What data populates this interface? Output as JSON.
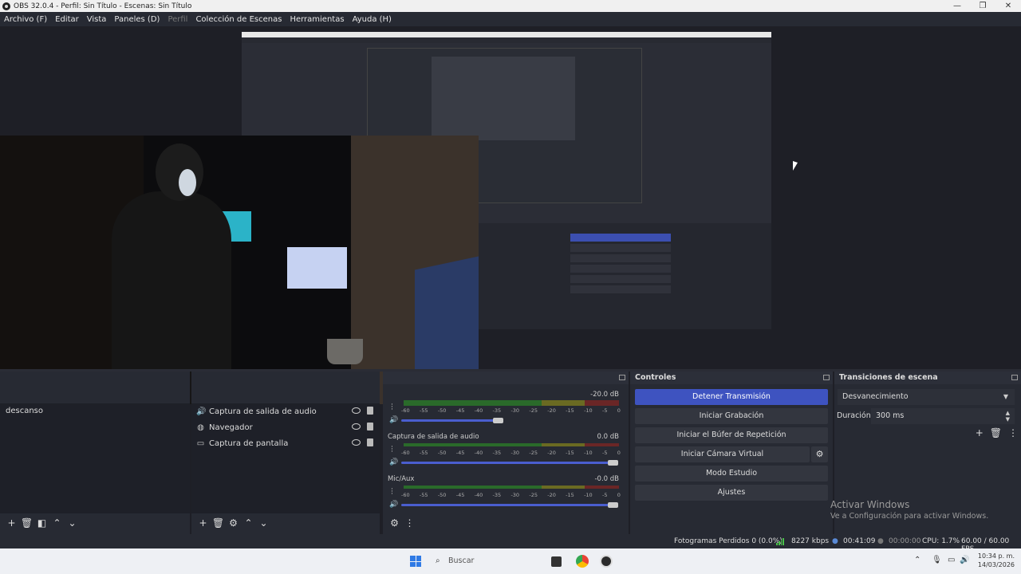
{
  "window": {
    "title": "OBS 32.0.4 - Perfil: Sin Título - Escenas: Sin Título",
    "controls": [
      "—",
      "❐",
      "✕"
    ]
  },
  "menu": [
    "Archivo (F)",
    "Editar",
    "Vista",
    "Paneles (D)",
    "Perfil",
    "Colección de Escenas",
    "Herramientas",
    "Ayuda (H)"
  ],
  "scenes": {
    "items": [
      "descanso"
    ]
  },
  "sources": {
    "items": [
      {
        "label": "Captura de salida de audio",
        "icon": "speaker-icon"
      },
      {
        "label": "Navegador",
        "icon": "globe-icon"
      },
      {
        "label": "Captura de pantalla",
        "icon": "monitor-icon"
      }
    ]
  },
  "mixer": {
    "tracks": [
      {
        "name": "",
        "db": "-20.0 dB",
        "volume": 0.47
      },
      {
        "name": "Captura de salida de audio",
        "db": "0.0 dB",
        "volume": 1.0
      },
      {
        "name": "Mic/Aux",
        "db": "-0.0 dB",
        "volume": 1.0
      }
    ],
    "ticks": [
      "-60",
      "-55",
      "-50",
      "-45",
      "-40",
      "-35",
      "-30",
      "-25",
      "-20",
      "-15",
      "-10",
      "-5",
      "0"
    ]
  },
  "controls": {
    "title": "Controles",
    "stop_stream": "Detener Transmisión",
    "start_recording": "Iniciar Grabación",
    "replay_buffer": "Iniciar el Búfer de Repetición",
    "virtual_camera": "Iniciar Cámara Virtual",
    "studio_mode": "Modo Estudio",
    "settings": "Ajustes"
  },
  "transitions": {
    "title": "Transiciones de escena",
    "selected": "Desvanecimiento",
    "duration_label": "Duración",
    "duration_value": "300 ms"
  },
  "activate": {
    "line1": "Activar Windows",
    "line2": "Ve a Configuración para activar Windows."
  },
  "status": {
    "dropped": "Fotogramas Perdidos 0 (0.0%)",
    "bitrate": "8227 kbps",
    "stream_time": "00:41:09",
    "rec_time": "00:00:00",
    "cpu": "CPU: 1.7%",
    "fps": "60.00 / 60.00 FPS"
  },
  "taskbar": {
    "search_placeholder": "Buscar",
    "time": "10:34 p. m.",
    "date": "14/03/2026"
  },
  "colors": {
    "accent": "#3e53c0",
    "bg": "#1e1f26",
    "dock": "#272a33"
  }
}
